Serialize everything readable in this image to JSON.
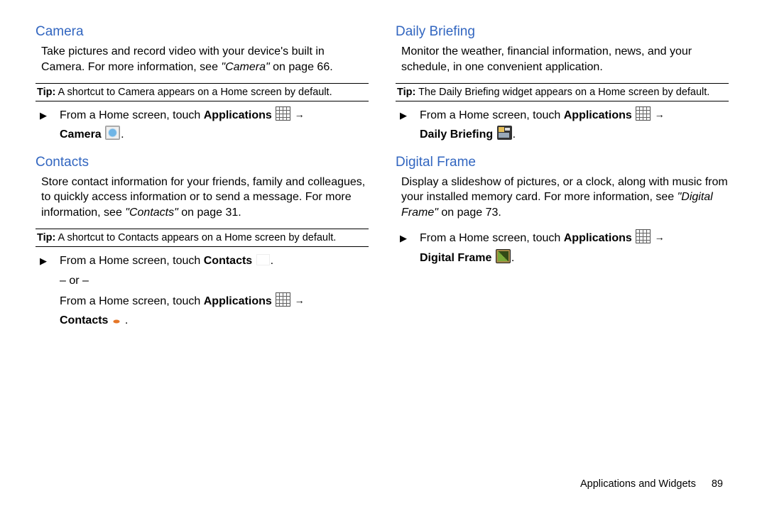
{
  "left": {
    "camera": {
      "title": "Camera",
      "body_pre": "Take pictures and record video with your device's built in Camera. For more information, see ",
      "xref": "\"Camera\"",
      "body_post": " on page 66.",
      "tip_label": "Tip:",
      "tip_text": " A shortcut to Camera appears on a Home screen by default.",
      "step_pre": "From a Home screen, touch ",
      "step_apps": "Applications",
      "arrow_label": "→",
      "step_app": "Camera",
      "period": "."
    },
    "contacts": {
      "title": "Contacts",
      "body_pre": "Store contact information for your friends, family and colleagues, to quickly access information or to send a message. For more information, see ",
      "xref": "\"Contacts\"",
      "body_post": " on page 31.",
      "tip_label": "Tip:",
      "tip_text": " A shortcut to Contacts appears on a Home screen by default.",
      "step1_pre": "From a Home screen, touch ",
      "step1_app": "Contacts",
      "or": "– or –",
      "step2_pre": "From a Home screen, touch ",
      "step2_apps": "Applications",
      "arrow_label": "→",
      "step2_app": "Contacts",
      "period": "."
    }
  },
  "right": {
    "briefing": {
      "title": "Daily Briefing",
      "body": "Monitor the weather, financial information, news, and your schedule, in one convenient application.",
      "tip_label": "Tip:",
      "tip_text": " The Daily Briefing widget appears on a Home screen by default.",
      "step_pre": "From a Home screen, touch ",
      "step_apps": "Applications",
      "arrow_label": "→",
      "step_app": "Daily Briefing",
      "period": "."
    },
    "frame": {
      "title": "Digital Frame",
      "body_pre": "Display a slideshow of pictures, or a clock, along with music from your installed memory card. For more information, see ",
      "xref": "\"Digital Frame\"",
      "body_post": " on page 73.",
      "step_pre": "From a Home screen, touch ",
      "step_apps": "Applications",
      "arrow_label": "→",
      "step_app": "Digital Frame",
      "period": "."
    }
  },
  "footer": {
    "section": "Applications and Widgets",
    "page": "89"
  }
}
